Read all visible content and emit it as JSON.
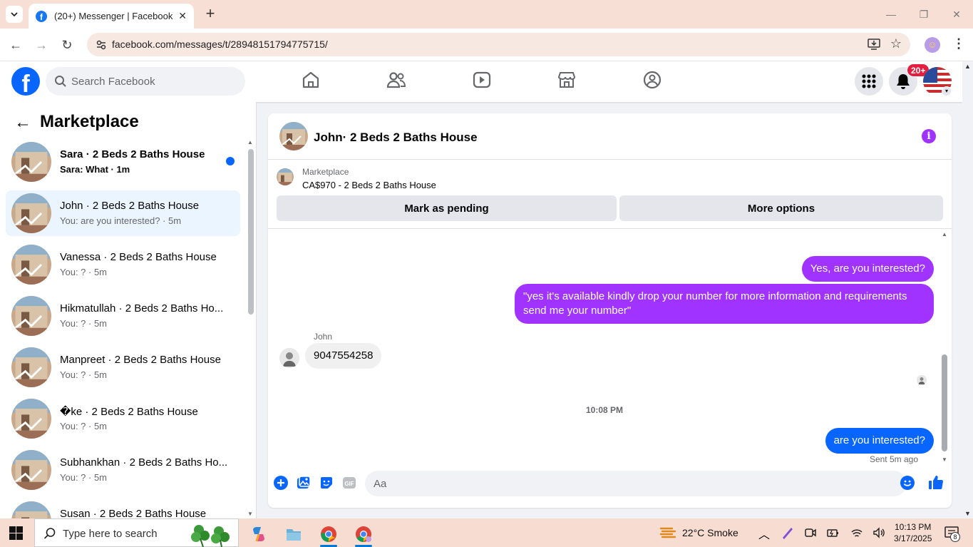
{
  "browser": {
    "tab_title": "(20+) Messenger | Facebook",
    "url": "facebook.com/messages/t/28948151794775715/"
  },
  "fb": {
    "logo_letter": "f",
    "search_placeholder": "Search Facebook",
    "notification_badge": "20+",
    "nav_icons": [
      "home-icon",
      "friends-icon",
      "video-icon",
      "marketplace-icon",
      "groups-icon"
    ]
  },
  "sidebar": {
    "title": "Marketplace",
    "conversations": [
      {
        "name": "Sara · 2 Beds 2 Baths House",
        "preview": "Sara: What · 1m",
        "unread": true,
        "active": false
      },
      {
        "name": "John · 2 Beds 2 Baths House",
        "preview": "You: are you interested? · 5m",
        "unread": false,
        "active": true
      },
      {
        "name": "Vanessa · 2 Beds 2 Baths House",
        "preview": "You: ? · 5m",
        "unread": false,
        "active": false
      },
      {
        "name": "Hikmatullah · 2 Beds 2 Baths Ho...",
        "preview": "You: ? · 5m",
        "unread": false,
        "active": false
      },
      {
        "name": "Manpreet · 2 Beds 2 Baths House",
        "preview": "You: ? · 5m",
        "unread": false,
        "active": false
      },
      {
        "name": "�ke · 2 Beds 2 Baths House",
        "preview": "You: ? · 5m",
        "unread": false,
        "active": false
      },
      {
        "name": "Subhankhan · 2 Beds 2 Baths Ho...",
        "preview": "You: ? · 5m",
        "unread": false,
        "active": false
      },
      {
        "name": "Susan · 2 Beds 2 Baths House",
        "preview": "",
        "unread": false,
        "active": false
      }
    ]
  },
  "chat": {
    "title": "John· 2 Beds 2 Baths House",
    "marketplace_label": "Marketplace",
    "listing": "CA$970 - 2 Beds 2 Baths House",
    "mark_pending": "Mark as pending",
    "more_options": "More options",
    "messages": {
      "out1": "Yes, are you interested?",
      "out2": "\"yes it's available kindly drop your number for more information and requirements send me your number\"",
      "in_sender": "John",
      "in1": "9047554258",
      "time": "10:08 PM",
      "out3": "are you  interested?",
      "status": "Sent 5m ago"
    },
    "composer_placeholder": "Aa"
  },
  "taskbar": {
    "search_placeholder": "Type here to search",
    "weather": "22°C  Smoke",
    "time": "10:13 PM",
    "date": "3/17/2025",
    "notification_count": "8"
  },
  "colors": {
    "fb_blue": "#0866ff",
    "purple_bubble": "#a033ff",
    "badge_red": "#e41e3f"
  }
}
